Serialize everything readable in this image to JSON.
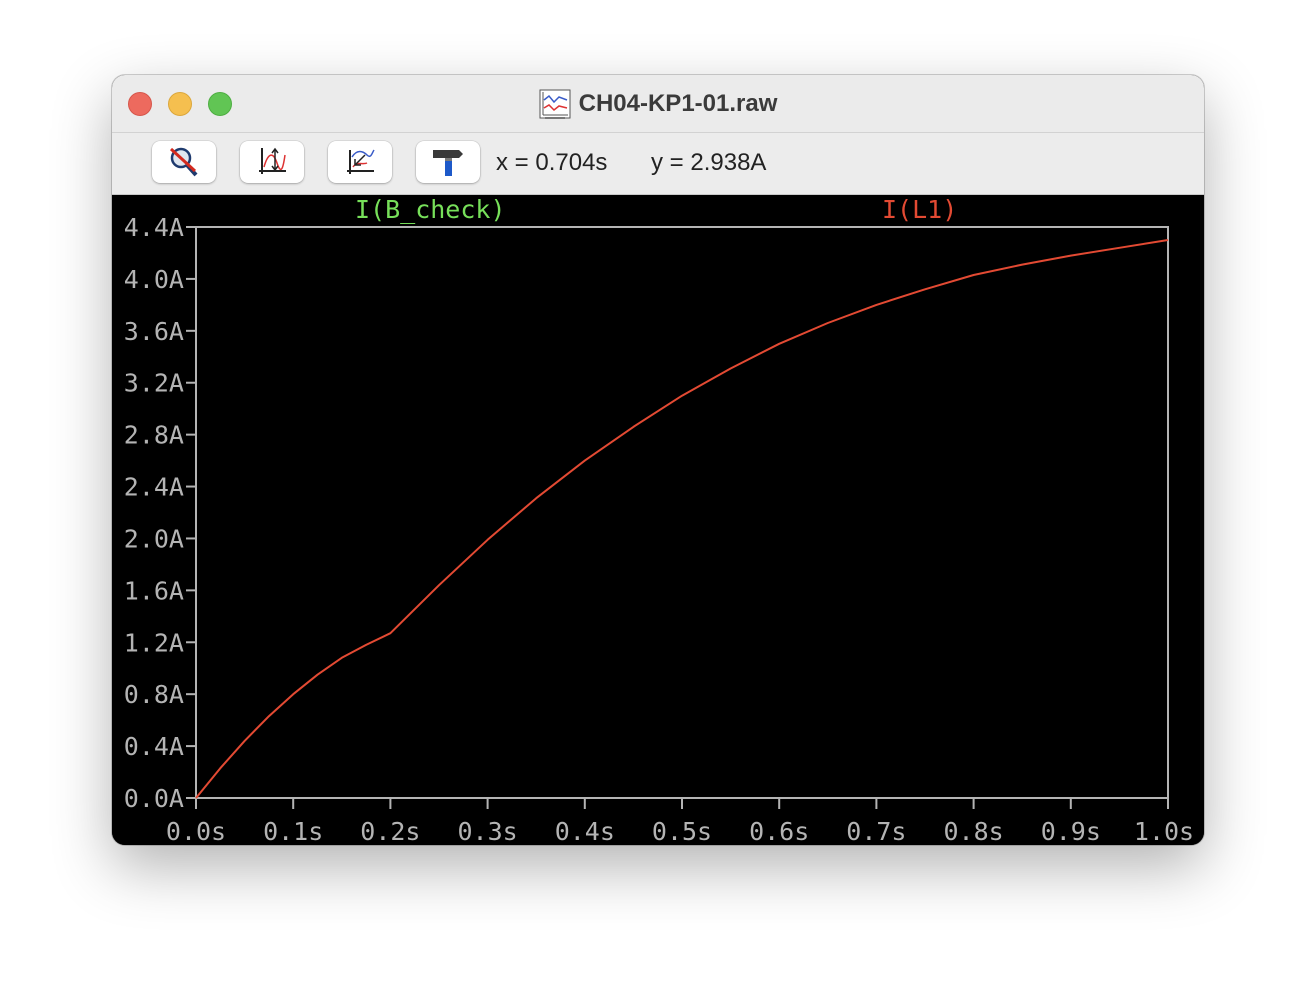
{
  "window": {
    "title": "CH04-KP1-01.raw",
    "icon": "waveform-file-icon"
  },
  "toolbar": {
    "buttons": [
      {
        "icon": "zoom-cancel-icon"
      },
      {
        "icon": "autorange-icon"
      },
      {
        "icon": "zoom-back-icon"
      },
      {
        "icon": "hammer-icon"
      }
    ],
    "cursor_x": "x = 0.704s",
    "cursor_y": "y = 2.938A"
  },
  "colors": {
    "trace_b_check": "#77e05a",
    "trace_l1": "#e34a33",
    "axis": "#b4b4b4",
    "background": "#000000"
  },
  "chart_data": {
    "type": "line",
    "xlim": [
      0,
      1.0
    ],
    "ylim": [
      0,
      4.4
    ],
    "xticks": [
      "0.0s",
      "0.1s",
      "0.2s",
      "0.3s",
      "0.4s",
      "0.5s",
      "0.6s",
      "0.7s",
      "0.8s",
      "0.9s",
      "1.0s"
    ],
    "yticks": [
      "0.0A",
      "0.4A",
      "0.8A",
      "1.2A",
      "1.6A",
      "2.0A",
      "2.4A",
      "2.8A",
      "3.2A",
      "3.6A",
      "4.0A",
      "4.4A"
    ],
    "legend": [
      "I(B_check)",
      "I(L1)"
    ],
    "grid": false,
    "series": [
      {
        "name": "I(L1)",
        "color": "#e34a33",
        "x": [
          0,
          0.025,
          0.05,
          0.075,
          0.1,
          0.125,
          0.15,
          0.175,
          0.2,
          0.25,
          0.3,
          0.35,
          0.4,
          0.45,
          0.5,
          0.55,
          0.6,
          0.65,
          0.7,
          0.75,
          0.8,
          0.85,
          0.9,
          0.95,
          1.0
        ],
        "y": [
          0,
          0.23,
          0.44,
          0.63,
          0.8,
          0.95,
          1.08,
          1.18,
          1.27,
          1.64,
          1.99,
          2.31,
          2.6,
          2.86,
          3.1,
          3.31,
          3.5,
          3.66,
          3.8,
          3.92,
          4.03,
          4.11,
          4.18,
          4.24,
          4.3
        ]
      }
    ]
  }
}
